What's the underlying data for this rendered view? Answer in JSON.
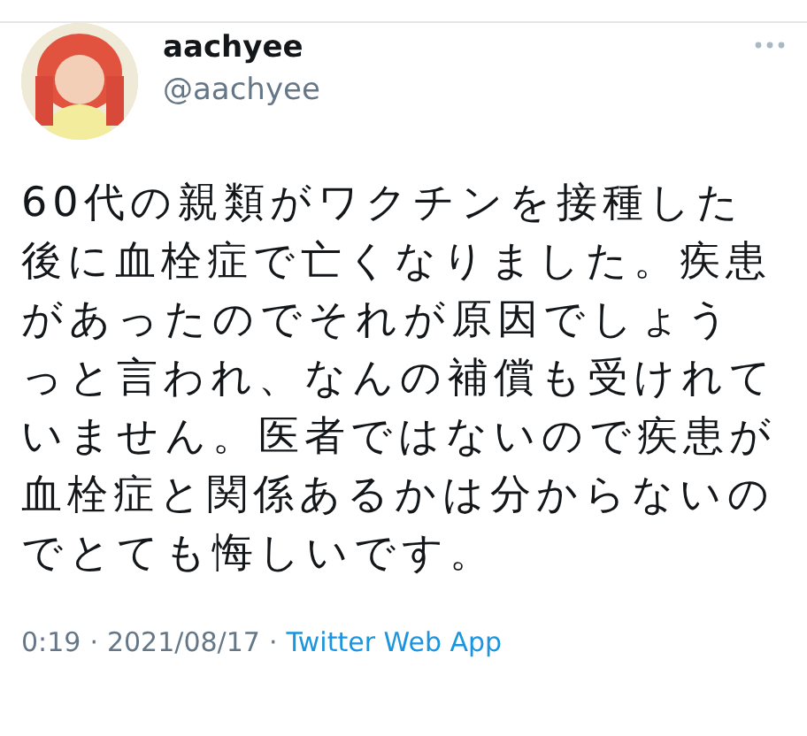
{
  "tweet": {
    "name": "aachyee",
    "handle": "@aachyee",
    "text": "60代の親類がワクチンを接種した後に血栓症で亡くなりました。疾患があったのでそれが原因でしょうっと言われ、なんの補償も受けれていません。医者ではないので疾患が血栓症と関係あるかは分からないのでとても悔しいです。",
    "time": "0:19",
    "separators": [
      "·",
      "·"
    ],
    "date": "2021/08/17",
    "source": "Twitter Web App"
  }
}
